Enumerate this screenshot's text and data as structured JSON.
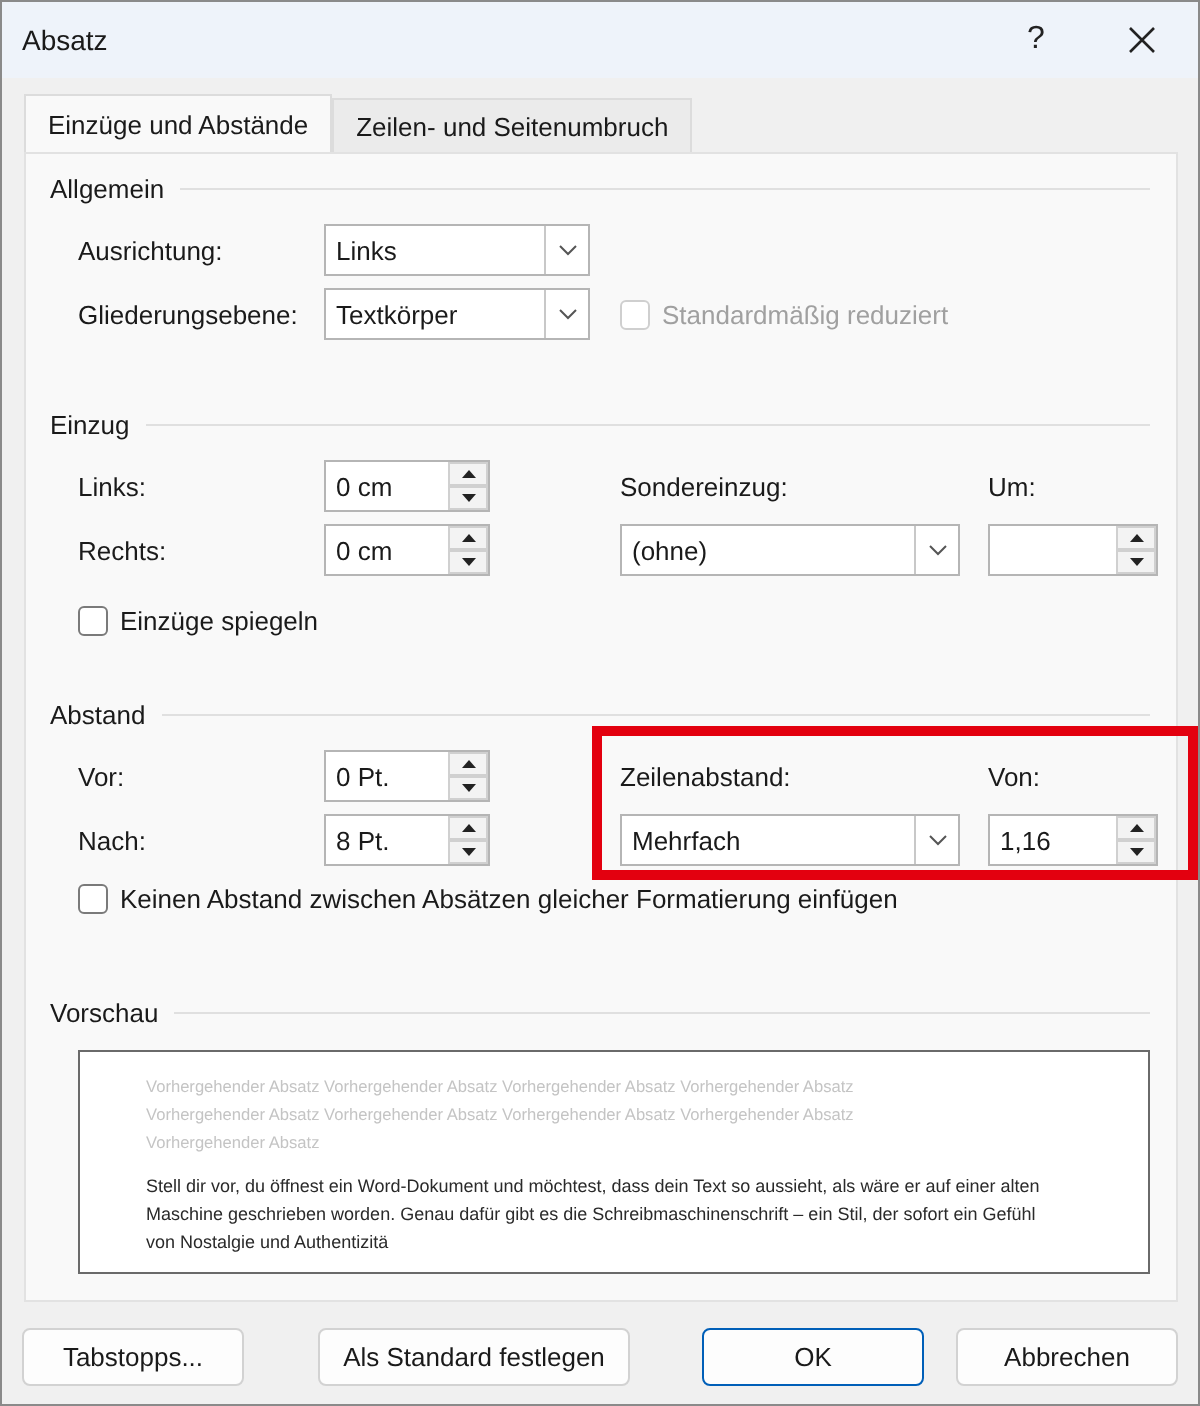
{
  "window": {
    "title": "Absatz",
    "help": "?"
  },
  "tabs": [
    {
      "label": "Einzüge und Abstände",
      "selected": true
    },
    {
      "label": "Zeilen- und Seitenumbruch",
      "selected": false
    }
  ],
  "general": {
    "title": "Allgemein",
    "alignment": {
      "label": "Ausrichtung:",
      "value": "Links"
    },
    "outline_level": {
      "label": "Gliederungsebene:",
      "value": "Textkörper"
    },
    "collapsed": {
      "label": "Standardmäßig reduziert",
      "checked": false,
      "disabled": true
    }
  },
  "indent": {
    "title": "Einzug",
    "left": {
      "label": "Links:",
      "value": "0 cm"
    },
    "right": {
      "label": "Rechts:",
      "value": "0 cm"
    },
    "special": {
      "label": "Sondereinzug:",
      "value": "(ohne)"
    },
    "by": {
      "label": "Um:"
    },
    "mirror": {
      "label": "Einzüge spiegeln",
      "checked": false,
      "disabled": false
    }
  },
  "spacing": {
    "title": "Abstand",
    "before": {
      "label": "Vor:",
      "value": "0 Pt."
    },
    "after": {
      "label": "Nach:",
      "value": "8 Pt."
    },
    "special": {
      "label": "Zeilenabstand:",
      "value": "Mehrfach"
    },
    "by": {
      "label": "Von:",
      "value": "1,16"
    },
    "no_space": {
      "label": "Keinen Abstand zwischen Absätzen gleicher Formatierung einfügen",
      "checked": false,
      "disabled": false
    },
    "highlighted": true
  },
  "preview": {
    "title": "Vorschau",
    "previous_text": "Vorhergehender Absatz Vorhergehender Absatz Vorhergehender Absatz Vorhergehender Absatz Vorhergehender Absatz Vorhergehender Absatz Vorhergehender Absatz Vorhergehender Absatz Vorhergehender Absatz",
    "current_text": "Stell dir vor, du öffnest ein Word-Dokument und möchtest, dass dein Text so aussieht, als wäre er auf einer alten Maschine geschrieben worden. Genau dafür gibt es die Schreibmaschinenschrift – ein Stil, der sofort ein Gefühl von Nostalgie und Authentizitä"
  },
  "buttons": [
    {
      "label": "Tabstopps...",
      "default": false
    },
    {
      "label": "Als Standard festlegen",
      "default": false
    },
    {
      "label": "OK",
      "default": true
    },
    {
      "label": "Abbrechen",
      "default": false
    }
  ]
}
